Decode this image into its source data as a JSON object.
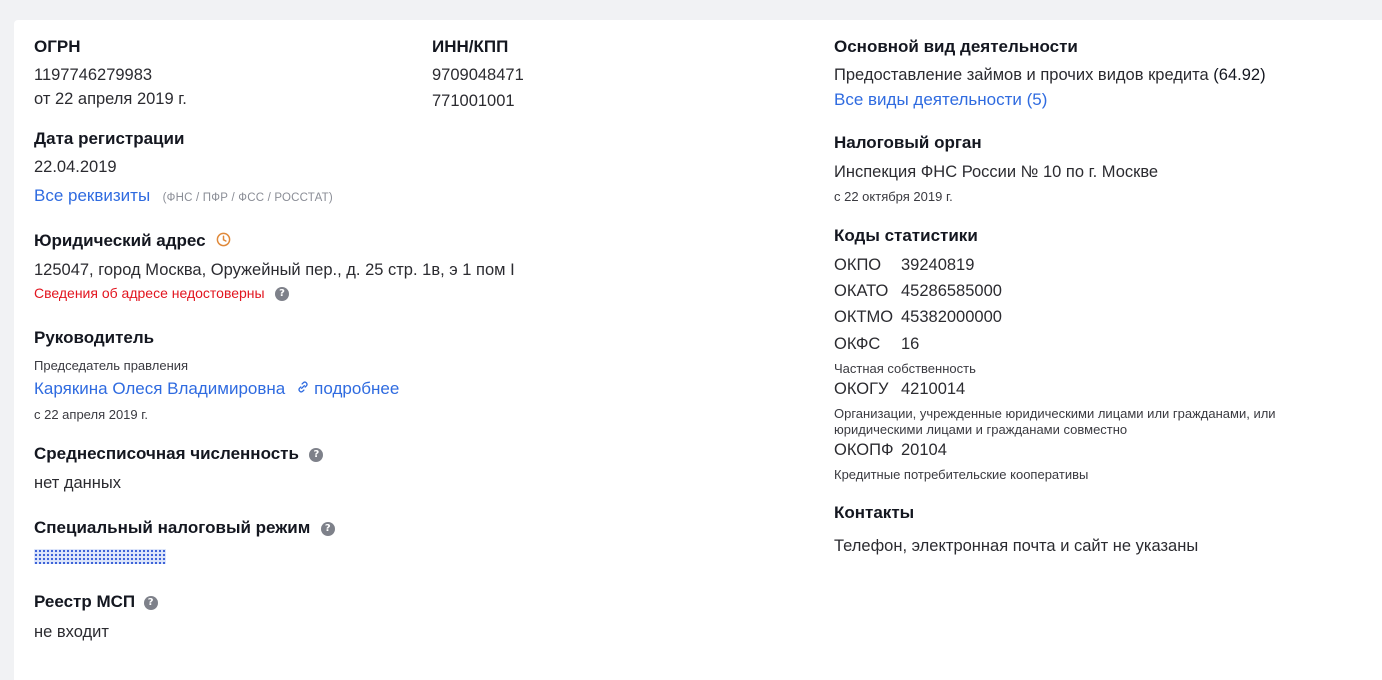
{
  "ogrn": {
    "label": "ОГРН",
    "value": "1197746279983",
    "date": "от 22 апреля 2019 г."
  },
  "inn_kpp": {
    "label": "ИНН/КПП",
    "inn": "9709048471",
    "kpp": "771001001"
  },
  "registration": {
    "label": "Дата регистрации",
    "value": "22.04.2019",
    "all_link": "Все реквизиты",
    "sources": "(ФНС / ПФР / ФСС / РОССТАТ)"
  },
  "address": {
    "label": "Юридический адрес",
    "value": "125047, город Москва, Оружейный пер., д. 25 стр. 1в, э 1 пом I",
    "warning": "Сведения об адресе недостоверны"
  },
  "director": {
    "label": "Руководитель",
    "position": "Председатель правления",
    "name": "Карякина Олеся Владимировна",
    "more_link": "подробнее",
    "since": "с 22 апреля 2019 г."
  },
  "headcount": {
    "label": "Среднесписочная численность",
    "value": "нет данных"
  },
  "tax_regime": {
    "label": "Специальный налоговый режим"
  },
  "msp": {
    "label": "Реестр МСП",
    "value": "не входит"
  },
  "activity": {
    "label": "Основной вид деятельности",
    "value": "Предоставление займов и прочих видов кредита",
    "code": "(64.92)",
    "all_link": "Все виды деятельности (5)"
  },
  "tax_authority": {
    "label": "Налоговый орган",
    "value": "Инспекция ФНС России № 10 по г. Москве",
    "since": "с 22 октября 2019 г."
  },
  "stats": {
    "label": "Коды статистики",
    "okpo": {
      "code": "ОКПО",
      "value": "39240819"
    },
    "okato": {
      "code": "ОКАТО",
      "value": "45286585000"
    },
    "oktmo": {
      "code": "ОКТМО",
      "value": "45382000000"
    },
    "okfs": {
      "code": "ОКФС",
      "value": "16",
      "desc": "Частная собственность"
    },
    "okogu": {
      "code": "ОКОГУ",
      "value": "4210014",
      "desc_line1": "Организации, учрежденные юридическими лицами или гражданами, или",
      "desc_line2": "юридическими лицами и гражданами совместно"
    },
    "okopf": {
      "code": "ОКОПФ",
      "value": "20104",
      "desc": "Кредитные потребительские кооперативы"
    }
  },
  "contacts": {
    "label": "Контакты",
    "value": "Телефон, электронная почта и сайт не указаны"
  },
  "icons": {
    "help": "question-circle-icon",
    "clock": "clock-icon",
    "link": "link-icon"
  },
  "colors": {
    "link": "#2f6be0",
    "warning": "#e2151f",
    "clock": "#e0893a"
  }
}
